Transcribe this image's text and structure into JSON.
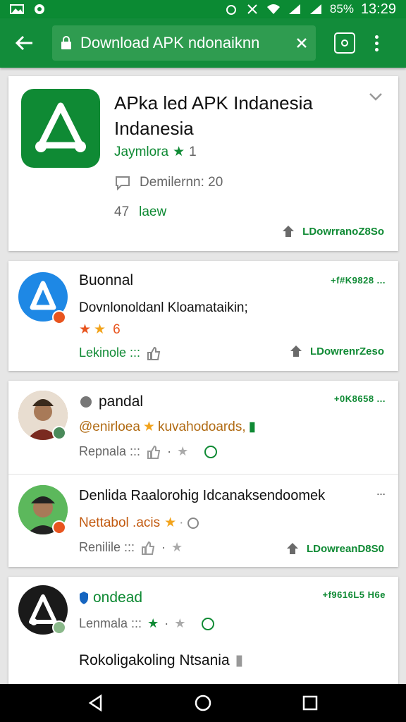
{
  "status_bar": {
    "battery": "85%",
    "time": "13:29"
  },
  "toolbar": {
    "url_text": "Download APK ndonaiknn"
  },
  "app_card": {
    "title": "APka led APK Indanesia Indanesia",
    "developer": "Jaymlora",
    "rating": "1",
    "comments": "Demilernn: 20",
    "meta_number": "47",
    "meta_label": "laew",
    "download_label": "LDowrranoZ8So"
  },
  "reviews": [
    {
      "name": "Buonnal",
      "meta": "+f#K9828 ...",
      "text": "Dovnlonoldanl Kloamataikin;",
      "rating": "6",
      "footer": "Lekinole :::",
      "download_label": "LDowrenrZeso"
    },
    {
      "name": "pandal",
      "meta": "+0K8658 ...",
      "text": "@enirloea",
      "text_highlight": "kuvahodoards,",
      "footer": "Repnala :::"
    },
    {
      "name": "Denlida Raalorohig Idcanaksendoomek",
      "meta": "...",
      "text": "Nettabol .acis",
      "footer": "Renilile :::",
      "download_label": "LDowreanD8S0"
    },
    {
      "name": "ondead",
      "meta": "+f9616L5 H6e",
      "text": "Lenmala :::",
      "title": "Rokoligakoling Ntsania"
    }
  ],
  "colors": {
    "brand_green": "#128c3a",
    "star_orange": "#f2a31b"
  }
}
